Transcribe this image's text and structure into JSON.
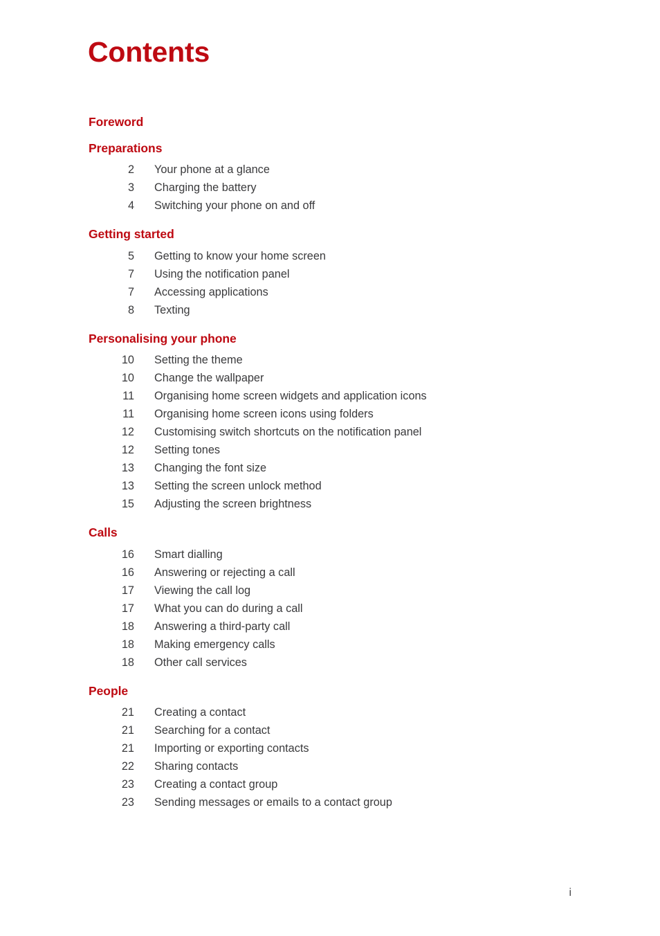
{
  "document": {
    "title": "Contents",
    "accent_color": "#be0a12",
    "body_text_color": "#3a3a3c",
    "background_color": "#ffffff"
  },
  "footer": {
    "page_number": "i"
  },
  "toc": {
    "sections": [
      {
        "heading": "Foreword",
        "entries": []
      },
      {
        "heading": "Preparations",
        "entries": [
          {
            "page": "2",
            "title": "Your phone at a glance"
          },
          {
            "page": "3",
            "title": "Charging the battery"
          },
          {
            "page": "4",
            "title": "Switching your phone on and off"
          }
        ]
      },
      {
        "heading": "Getting started",
        "entries": [
          {
            "page": "5",
            "title": "Getting to know your home screen"
          },
          {
            "page": "7",
            "title": "Using the notification panel"
          },
          {
            "page": "7",
            "title": "Accessing applications"
          },
          {
            "page": "8",
            "title": "Texting"
          }
        ]
      },
      {
        "heading": "Personalising your phone",
        "entries": [
          {
            "page": "10",
            "title": "Setting the theme"
          },
          {
            "page": "10",
            "title": "Change the wallpaper"
          },
          {
            "page": "11",
            "title": "Organising home screen widgets and application icons"
          },
          {
            "page": "11",
            "title": "Organising home screen icons using folders"
          },
          {
            "page": "12",
            "title": "Customising switch shortcuts on the notification panel"
          },
          {
            "page": "12",
            "title": "Setting tones"
          },
          {
            "page": "13",
            "title": "Changing the font size"
          },
          {
            "page": "13",
            "title": "Setting the screen unlock method"
          },
          {
            "page": "15",
            "title": "Adjusting the screen brightness"
          }
        ]
      },
      {
        "heading": "Calls",
        "entries": [
          {
            "page": "16",
            "title": "Smart dialling"
          },
          {
            "page": "16",
            "title": "Answering or rejecting a call"
          },
          {
            "page": "17",
            "title": "Viewing the call log"
          },
          {
            "page": "17",
            "title": "What you can do during a call"
          },
          {
            "page": "18",
            "title": "Answering a third-party call"
          },
          {
            "page": "18",
            "title": "Making emergency calls"
          },
          {
            "page": "18",
            "title": "Other call services"
          }
        ]
      },
      {
        "heading": "People",
        "entries": [
          {
            "page": "21",
            "title": "Creating a contact"
          },
          {
            "page": "21",
            "title": "Searching for a contact"
          },
          {
            "page": "21",
            "title": "Importing or exporting contacts"
          },
          {
            "page": "22",
            "title": "Sharing contacts"
          },
          {
            "page": "23",
            "title": "Creating a contact group"
          },
          {
            "page": "23",
            "title": "Sending messages or emails to a contact group"
          }
        ]
      }
    ]
  }
}
